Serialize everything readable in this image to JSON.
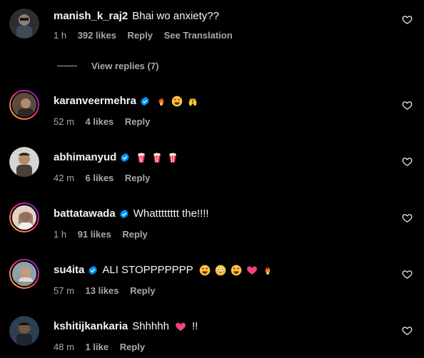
{
  "icons": {
    "like": "heart-outline-icon",
    "verified": "verified-badge-icon"
  },
  "colors": {
    "background": "#000000",
    "text": "#f5f5f5",
    "meta": "#a8a8a8",
    "verified": "#0095f6",
    "story_ring_start": "#f9ce34",
    "story_ring_end": "#6228d7"
  },
  "view_replies": {
    "label": "View replies (7)"
  },
  "comments": [
    {
      "username": "manish_k_raj2",
      "verified": false,
      "text": "Bhai wo anxiety??",
      "emojis": [],
      "time": "1 h",
      "likes": "392 likes",
      "reply": "Reply",
      "translate": "See Translation"
    },
    {
      "username": "karanveermehra",
      "verified": true,
      "text": "",
      "emojis": [
        "fire-emoji",
        "heart-eyes-emoji",
        "raised-hands-emoji"
      ],
      "time": "52 m",
      "likes": "4 likes",
      "reply": "Reply"
    },
    {
      "username": "abhimanyud",
      "verified": true,
      "text": "",
      "emojis": [
        "popcorn-emoji",
        "popcorn-emoji",
        "popcorn-emoji"
      ],
      "time": "42 m",
      "likes": "6 likes",
      "reply": "Reply"
    },
    {
      "username": "battatawada",
      "verified": true,
      "text": "Whatttttttt the!!!!",
      "emojis": [],
      "time": "1 h",
      "likes": "91 likes",
      "reply": "Reply"
    },
    {
      "username": "su4ita",
      "verified": true,
      "text": "ALI STOPPPPPPP",
      "emojis": [
        "heart-eyes-emoji",
        "flushed-emoji",
        "heart-eyes-emoji",
        "pink-heart-emoji",
        "fire-emoji"
      ],
      "time": "57 m",
      "likes": "13 likes",
      "reply": "Reply"
    },
    {
      "username": "kshitijkankaria",
      "verified": false,
      "text": "Shhhhh",
      "emojis": [
        "pink-heart-emoji"
      ],
      "suffix": "!!",
      "time": "48 m",
      "likes": "1 like",
      "reply": "Reply"
    }
  ]
}
